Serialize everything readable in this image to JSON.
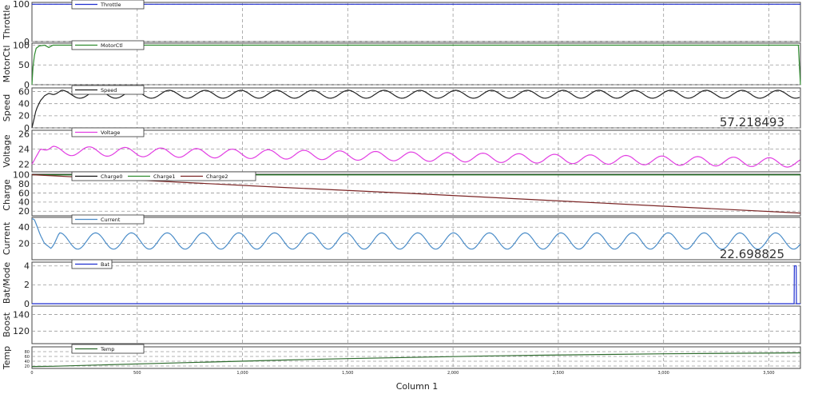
{
  "chart_data": {
    "type": "line",
    "xlabel": "Column 1",
    "xlim": [
      0,
      3650
    ],
    "x_ticks": [
      0,
      500,
      1000,
      1500,
      2000,
      2500,
      3000,
      3500
    ],
    "x_tick_labels": [
      "0",
      "500",
      "1,000",
      "1,500",
      "2,000",
      "2,500",
      "3,000",
      "3,500"
    ],
    "panels": [
      {
        "ylabel": "Throttle",
        "ylim": [
          0,
          105
        ],
        "y_ticks": [
          0,
          100
        ],
        "series": [
          {
            "name": "Throttle",
            "color": "#1f2fd0",
            "x": [
              0,
              3650
            ],
            "y": [
              100,
              100
            ]
          }
        ]
      },
      {
        "ylabel": "MotorCtl",
        "ylim": [
          0,
          105
        ],
        "y_ticks": [
          0,
          50,
          100
        ],
        "series": [
          {
            "name": "MotorCtl",
            "color": "#2e8b2e",
            "x": [
              0,
              5,
              12,
              20,
              35,
              60,
              80,
              100,
              150,
              3640,
              3650
            ],
            "y": [
              0,
              45,
              75,
              92,
              98,
              100,
              94,
              100,
              100,
              100,
              0
            ]
          }
        ]
      },
      {
        "ylabel": "Speed",
        "ylim": [
          0,
          66
        ],
        "y_ticks": [
          0,
          20,
          40,
          60
        ],
        "readout": "57.218493",
        "series": [
          {
            "name": "Speed",
            "color": "#222222",
            "x": [
              0,
              20,
              40,
              60,
              80,
              100,
              3650
            ],
            "y": [
              0,
              30,
              45,
              53,
              57,
              55,
              50
            ],
            "oscillation": {
              "from": 100,
              "to": 3650,
              "center": 55.5,
              "amplitude": 6.5,
              "period": 170
            }
          }
        ]
      },
      {
        "ylabel": "Voltage",
        "ylim": [
          21,
          26.5
        ],
        "y_ticks": [
          22,
          24,
          26
        ],
        "series": [
          {
            "name": "Voltage",
            "color": "#e23ee2",
            "x": [
              0,
              20,
              40,
              80,
              3650
            ],
            "y": [
              22,
              23,
              24,
              23.8,
              22.8
            ],
            "oscillation": {
              "from": 60,
              "to": 3650,
              "center_start": 23.8,
              "center_end": 22.2,
              "amplitude": 0.6,
              "period": 170
            }
          }
        ]
      },
      {
        "ylabel": "Charge",
        "ylim": [
          10,
          101
        ],
        "y_ticks": [
          20,
          40,
          60,
          80,
          100
        ],
        "series": [
          {
            "name": "Charge0",
            "color": "#111111",
            "x": [
              0,
              3650
            ],
            "y": [
              100,
              100
            ]
          },
          {
            "name": "Charge1",
            "color": "#2e8b2e",
            "x": [
              0,
              3650
            ],
            "y": [
              99.6,
              99.6
            ]
          },
          {
            "name": "Charge2",
            "color": "#7a2424",
            "x": [
              0,
              600,
              1200,
              1800,
              2400,
              3000,
              3650
            ],
            "y": [
              100,
              86,
              72,
              59,
              45,
              31,
              16
            ]
          }
        ]
      },
      {
        "ylabel": "Current",
        "ylim": [
          0,
          52
        ],
        "y_ticks": [
          20,
          40
        ],
        "readout": "22.698825",
        "series": [
          {
            "name": "Current",
            "color": "#4a8cc8",
            "x": [
              0,
              10,
              20,
              40,
              60,
              90
            ],
            "y": [
              50,
              50,
              44,
              30,
              20,
              14
            ],
            "oscillation": {
              "from": 90,
              "to": 3650,
              "center": 23,
              "amplitude": 10,
              "period": 170
            }
          }
        ]
      },
      {
        "ylabel": "Bat/Mode",
        "ylim": [
          0,
          4.4
        ],
        "y_ticks": [
          0,
          2,
          4
        ],
        "series": [
          {
            "name": "Bat",
            "color": "#1f2fd0",
            "x": [
              0,
              3620,
              3621,
              3630,
              3631,
              3650
            ],
            "y": [
              0,
              0,
              4,
              4,
              0,
              0
            ]
          }
        ]
      },
      {
        "ylabel": "Boost",
        "ylim": [
          105,
          150
        ],
        "y_ticks": [
          120,
          140
        ],
        "series": []
      },
      {
        "ylabel": "Temp",
        "ylim": [
          10,
          100
        ],
        "y_ticks": [
          20,
          40,
          60,
          80
        ],
        "series": [
          {
            "name": "Temp",
            "color": "#2e6b2e",
            "x": [
              0,
              100,
              300,
              600,
              900,
              1200,
              1500,
              1800,
              2100,
              2400,
              2700,
              3000,
              3300,
              3650
            ],
            "y": [
              18,
              19,
              24,
              31,
              38,
              45,
              51,
              56,
              61,
              65,
              68,
              71,
              73,
              75
            ]
          }
        ]
      }
    ]
  }
}
